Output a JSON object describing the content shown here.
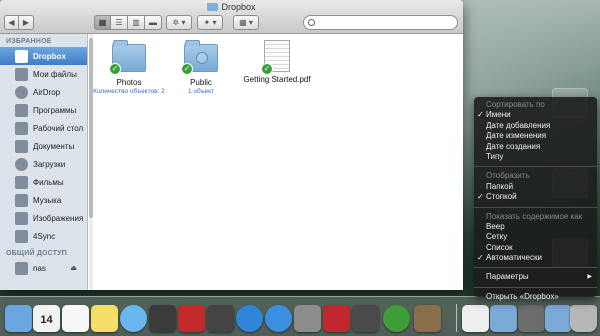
{
  "finder": {
    "title": "Dropbox",
    "nav_back": "◀",
    "nav_forward": "▶",
    "view_buttons": [
      "▦",
      "☰",
      "▥",
      "▬"
    ],
    "action_label": "✲ ▾",
    "dropbox_btn": "✦ ▾",
    "arrange_btn": "▦ ▾",
    "search_placeholder": ""
  },
  "sidebar": {
    "favorites_heading": "ИЗБРАННОЕ",
    "items": [
      {
        "label": "Dropbox",
        "icon": "dropbox-icon",
        "selected": true
      },
      {
        "label": "Мои файлы",
        "icon": "all-files-icon"
      },
      {
        "label": "AirDrop",
        "icon": "airdrop-icon"
      },
      {
        "label": "Программы",
        "icon": "applications-icon"
      },
      {
        "label": "Рабочий стол",
        "icon": "desktop-icon"
      },
      {
        "label": "Документы",
        "icon": "documents-icon"
      },
      {
        "label": "Загрузки",
        "icon": "downloads-icon"
      },
      {
        "label": "Фильмы",
        "icon": "movies-icon"
      },
      {
        "label": "Музыка",
        "icon": "music-icon"
      },
      {
        "label": "Изображения",
        "icon": "pictures-icon"
      },
      {
        "label": "4Sync",
        "icon": "folder-icon"
      }
    ],
    "shared_heading": "ОБЩИЙ ДОСТУП",
    "shared_items": [
      {
        "label": "nas",
        "icon": "server-icon",
        "eject": "⏏"
      }
    ]
  },
  "files": [
    {
      "name": "Photos",
      "info": "Количество объектов: 2",
      "type": "folder"
    },
    {
      "name": "Public",
      "info": "1 объект",
      "type": "folder-public"
    },
    {
      "name": "Getting Started.pdf",
      "info": "",
      "type": "pdf"
    }
  ],
  "context_menu": {
    "sort_header": "Сортировать по",
    "sort_items": [
      {
        "label": "Имени",
        "checked": true
      },
      {
        "label": "Дате добавления",
        "checked": false
      },
      {
        "label": "Дате изменения",
        "checked": false
      },
      {
        "label": "Дате создания",
        "checked": false
      },
      {
        "label": "Типу",
        "checked": false
      }
    ],
    "display_header": "Отобразить",
    "display_items": [
      {
        "label": "Папкой",
        "checked": false
      },
      {
        "label": "Стопкой",
        "checked": true
      }
    ],
    "content_header": "Показать содержимое как",
    "content_items": [
      {
        "label": "Веер",
        "checked": false
      },
      {
        "label": "Сетку",
        "checked": false
      },
      {
        "label": "Список",
        "checked": false
      },
      {
        "label": "Автоматически",
        "checked": true
      }
    ],
    "options": "Параметры",
    "open": "Открыть «Dropbox»",
    "check_glyph": "✓",
    "arrow_glyph": "▶"
  },
  "dock": {
    "calendar_day": "14",
    "items": [
      {
        "name": "finder-dock-icon",
        "color": "#6aa6e0"
      },
      {
        "name": "calendar-dock-icon",
        "color": "#f2f2f2"
      },
      {
        "name": "reminders-dock-icon",
        "color": "#f7f7f7"
      },
      {
        "name": "notes-dock-icon",
        "color": "#f5df6a"
      },
      {
        "name": "messages-dock-icon",
        "color": "#69b7ee"
      },
      {
        "name": "facetime-dock-icon",
        "color": "#3b3b3b"
      },
      {
        "name": "photo-booth-dock-icon",
        "color": "#c42a2a"
      },
      {
        "name": "iphoto-dock-icon",
        "color": "#444444"
      },
      {
        "name": "itunes-dock-icon",
        "color": "#2f86d8"
      },
      {
        "name": "app-store-dock-icon",
        "color": "#3a8fe0"
      },
      {
        "name": "system-preferences-dock-icon",
        "color": "#8c8c8c"
      },
      {
        "name": "photo-booth-2-dock-icon",
        "color": "#c0282e"
      },
      {
        "name": "vlc-dock-icon",
        "color": "#4a4a4a"
      },
      {
        "name": "utorrent-dock-icon",
        "color": "#3d9e3a"
      },
      {
        "name": "archive-dock-icon",
        "color": "#8a6d4a"
      },
      {
        "name": "document-dock-icon",
        "color": "#eeeeee"
      },
      {
        "name": "applications-folder-dock-icon",
        "color": "#7aaad6"
      },
      {
        "name": "dropbox-stack-dock-icon",
        "color": "#6d6d6d"
      },
      {
        "name": "downloads-folder-dock-icon",
        "color": "#7aaad6"
      },
      {
        "name": "trash-dock-icon",
        "color": "#b7b7b7"
      }
    ]
  }
}
